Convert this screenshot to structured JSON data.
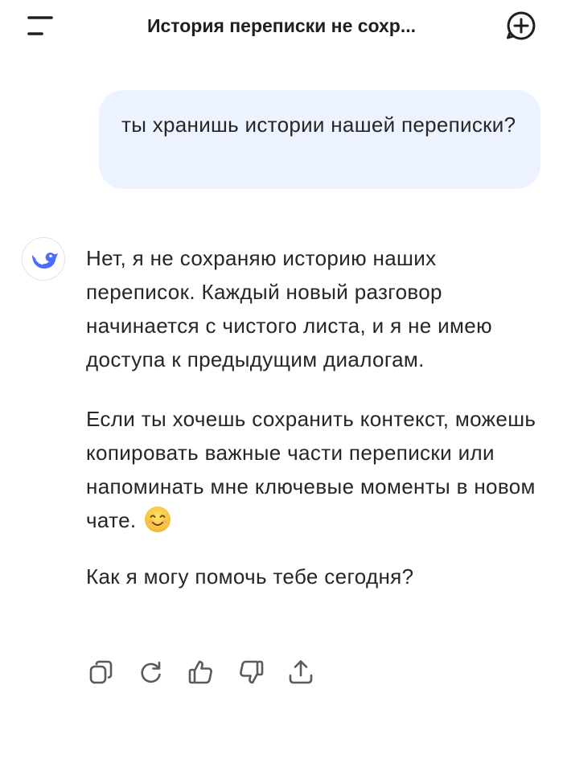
{
  "header": {
    "title": "История переписки не сохр...",
    "menu_icon": "menu-icon",
    "new_chat_icon": "plus-circle-icon"
  },
  "user_message": {
    "text": "ты хранишь истории нашей переписки?"
  },
  "assistant_message": {
    "avatar_icon": "deepseek-whale-logo",
    "paragraphs": [
      "Нет, я не сохраняю историю наших переписок. Каждый новый разговор начинается с чистого листа, и я не имею доступа к предыдущим диалогам.",
      "Если ты хочешь сохранить контекст, можешь копировать важные части переписки или напоминать мне ключевые моменты в новом чате.",
      "Как я могу помочь тебе сегодня?"
    ],
    "emoji": "😊"
  },
  "actions": [
    {
      "icon": "copy-icon"
    },
    {
      "icon": "regenerate-icon"
    },
    {
      "icon": "thumbs-up-icon"
    },
    {
      "icon": "thumbs-down-icon"
    },
    {
      "icon": "share-icon"
    }
  ],
  "colors": {
    "user_bubble_bg": "#edf3fe",
    "text": "#262626",
    "icon": "#5a5a5a",
    "brand_blue": "#4d6bfe"
  }
}
